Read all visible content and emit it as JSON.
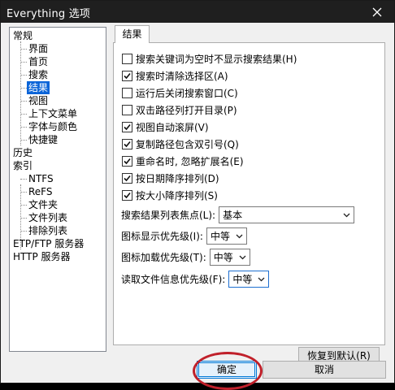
{
  "window": {
    "title": "Everything 选项",
    "close_icon": "close-icon"
  },
  "tree": {
    "items": [
      {
        "label": "常规",
        "level": 0
      },
      {
        "label": "界面",
        "level": 1
      },
      {
        "label": "首页",
        "level": 1
      },
      {
        "label": "搜索",
        "level": 1
      },
      {
        "label": "结果",
        "level": 1,
        "selected": true
      },
      {
        "label": "视图",
        "level": 1
      },
      {
        "label": "上下文菜单",
        "level": 1
      },
      {
        "label": "字体与颜色",
        "level": 1
      },
      {
        "label": "快捷键",
        "level": 1
      },
      {
        "label": "历史",
        "level": 0
      },
      {
        "label": "索引",
        "level": 0
      },
      {
        "label": "NTFS",
        "level": 1
      },
      {
        "label": "ReFS",
        "level": 1
      },
      {
        "label": "文件夹",
        "level": 1
      },
      {
        "label": "文件列表",
        "level": 1
      },
      {
        "label": "排除列表",
        "level": 1
      },
      {
        "label": "ETP/FTP 服务器",
        "level": 0
      },
      {
        "label": "HTTP 服务器",
        "level": 0
      }
    ]
  },
  "panel": {
    "tab_label": "结果",
    "checkboxes": [
      {
        "label": "搜索关键词为空时不显示搜索结果(H)",
        "checked": false
      },
      {
        "label": "搜索时清除选择区(A)",
        "checked": true
      },
      {
        "label": "运行后关闭搜索窗口(C)",
        "checked": false
      },
      {
        "label": "双击路径列打开目录(P)",
        "checked": false
      },
      {
        "label": "视图自动滚屏(V)",
        "checked": true
      },
      {
        "label": "复制路径包含双引号(Q)",
        "checked": true
      },
      {
        "label": "重命名时, 忽略扩展名(E)",
        "checked": true
      },
      {
        "label": "按日期降序排列(D)",
        "checked": true
      },
      {
        "label": "按大小降序排列(S)",
        "checked": true
      }
    ],
    "fields": [
      {
        "label": "搜索结果列表焦点(L):",
        "value": "基本"
      },
      {
        "label": "图标显示优先级(I):",
        "value": "中等"
      },
      {
        "label": "图标加载优先级(T):",
        "value": "中等"
      },
      {
        "label": "读取文件信息优先级(F):",
        "value": "中等"
      }
    ],
    "restore_label": "恢复到默认(R)"
  },
  "footer": {
    "ok_label": "确定",
    "cancel_label": "取消"
  },
  "colors": {
    "selection": "#0a64d8",
    "annotation_circle": "#c0202a",
    "titlebar": "#1f1f1f"
  }
}
